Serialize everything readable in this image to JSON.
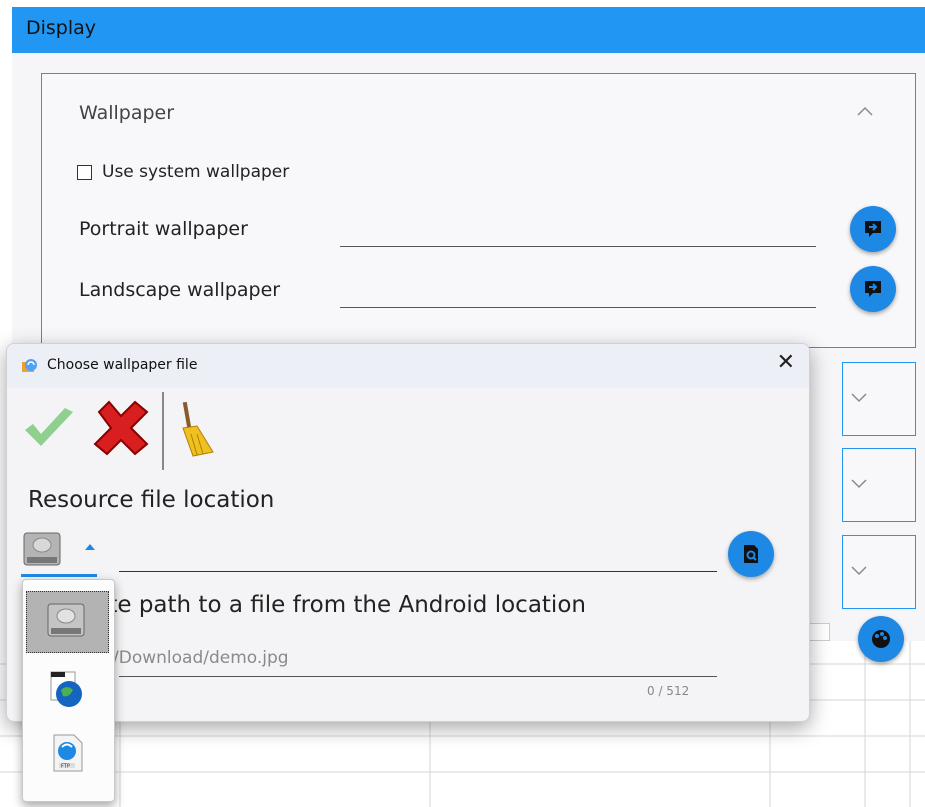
{
  "window": {
    "title": "Display"
  },
  "wallpaper_section": {
    "title": "Wallpaper",
    "use_system_label": "Use system wallpaper",
    "portrait_label": "Portrait wallpaper",
    "landscape_label": "Landscape wallpaper"
  },
  "dialog": {
    "title": "Choose wallpaper file",
    "close_glyph": "✕",
    "resource_label": "Resource file location",
    "abs_path_label": "Absolute path to a file from the Android location",
    "path_placeholder": "/Download/demo.jpg",
    "char_counter": "0 / 512"
  },
  "location_options": [
    "drive-icon",
    "web-file-icon",
    "ftp-icon"
  ],
  "icons": {
    "chevron_up": "chevron-up-icon",
    "chevron_down": "chevron-down-icon",
    "pick": "arrow-right-box-icon",
    "browse": "file-search-icon",
    "ok": "check-icon",
    "cancel": "red-x-icon",
    "clear": "broom-icon"
  },
  "colors": {
    "accent": "#2196f3",
    "button": "#1e88e5",
    "ok": "#7ed07e",
    "cancel": "#e02020"
  }
}
